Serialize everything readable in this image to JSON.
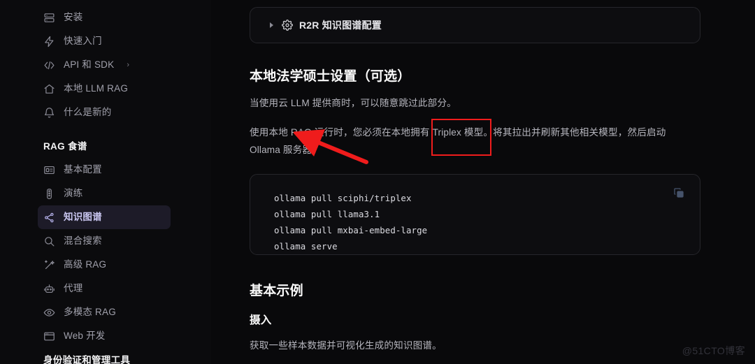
{
  "sidebar": {
    "top_items": [
      {
        "label": "安装",
        "icon": "server-icon",
        "active": false,
        "chevron": ""
      },
      {
        "label": "快速入门",
        "icon": "lightning-icon",
        "active": false,
        "chevron": ""
      },
      {
        "label": "API 和 SDK",
        "icon": "code-icon",
        "active": false,
        "chevron": "›"
      },
      {
        "label": "本地 LLM RAG",
        "icon": "home-icon",
        "active": false,
        "chevron": ""
      },
      {
        "label": "什么是新的",
        "icon": "bell-icon",
        "active": false,
        "chevron": ""
      }
    ],
    "group_title": "RAG 食谱",
    "group_items": [
      {
        "label": "基本配置",
        "icon": "id-card-icon",
        "active": false,
        "chevron": ""
      },
      {
        "label": "演练",
        "icon": "vertical-dots-icon",
        "active": false,
        "chevron": ""
      },
      {
        "label": "知识图谱",
        "icon": "graph-icon",
        "active": true,
        "chevron": ""
      },
      {
        "label": "混合搜索",
        "icon": "search-icon",
        "active": false,
        "chevron": ""
      },
      {
        "label": "高级 RAG",
        "icon": "sparkle-wand-icon",
        "active": false,
        "chevron": ""
      },
      {
        "label": "代理",
        "icon": "robot-icon",
        "active": false,
        "chevron": ""
      },
      {
        "label": "多模态 RAG",
        "icon": "eye-icon",
        "active": false,
        "chevron": ""
      },
      {
        "label": "Web 开发",
        "icon": "browser-icon",
        "active": false,
        "chevron": ""
      }
    ],
    "next_group_title": "身份验证和管理工具"
  },
  "main": {
    "accordion": {
      "title": "R2R 知识图谱配置",
      "toggle_icon": "triangle-right-icon",
      "leading_icon": "gear-icon",
      "expanded": false
    },
    "section_heading": "本地法学硕士设置（可选）",
    "paragraph_1": "当使用云 LLM 提供商时，可以随意跳过此部分。",
    "paragraph_2": "使用本地 RAG 运行时，您必须在本地拥有 Triplex 模型。将其拉出并刷新其他相关模型，然后启动 Ollama 服务器。",
    "code": {
      "copy_icon": "copy-icon",
      "lines": [
        "ollama pull sciphi/triplex",
        "ollama pull llama3.1",
        "ollama pull mxbai-embed-large",
        "ollama serve"
      ]
    },
    "basic_heading": "基本示例",
    "ingest_heading": "摄入",
    "ingest_paragraph": "获取一些样本数据并可视化生成的知识图谱。"
  },
  "annotations": {
    "highlight_color": "#ef1c1c",
    "box_label": "highlight-around-Triplex-模型",
    "arrow_label": "red-arrow-pointing-to-paragraph"
  },
  "watermark": "@51CTO博客"
}
